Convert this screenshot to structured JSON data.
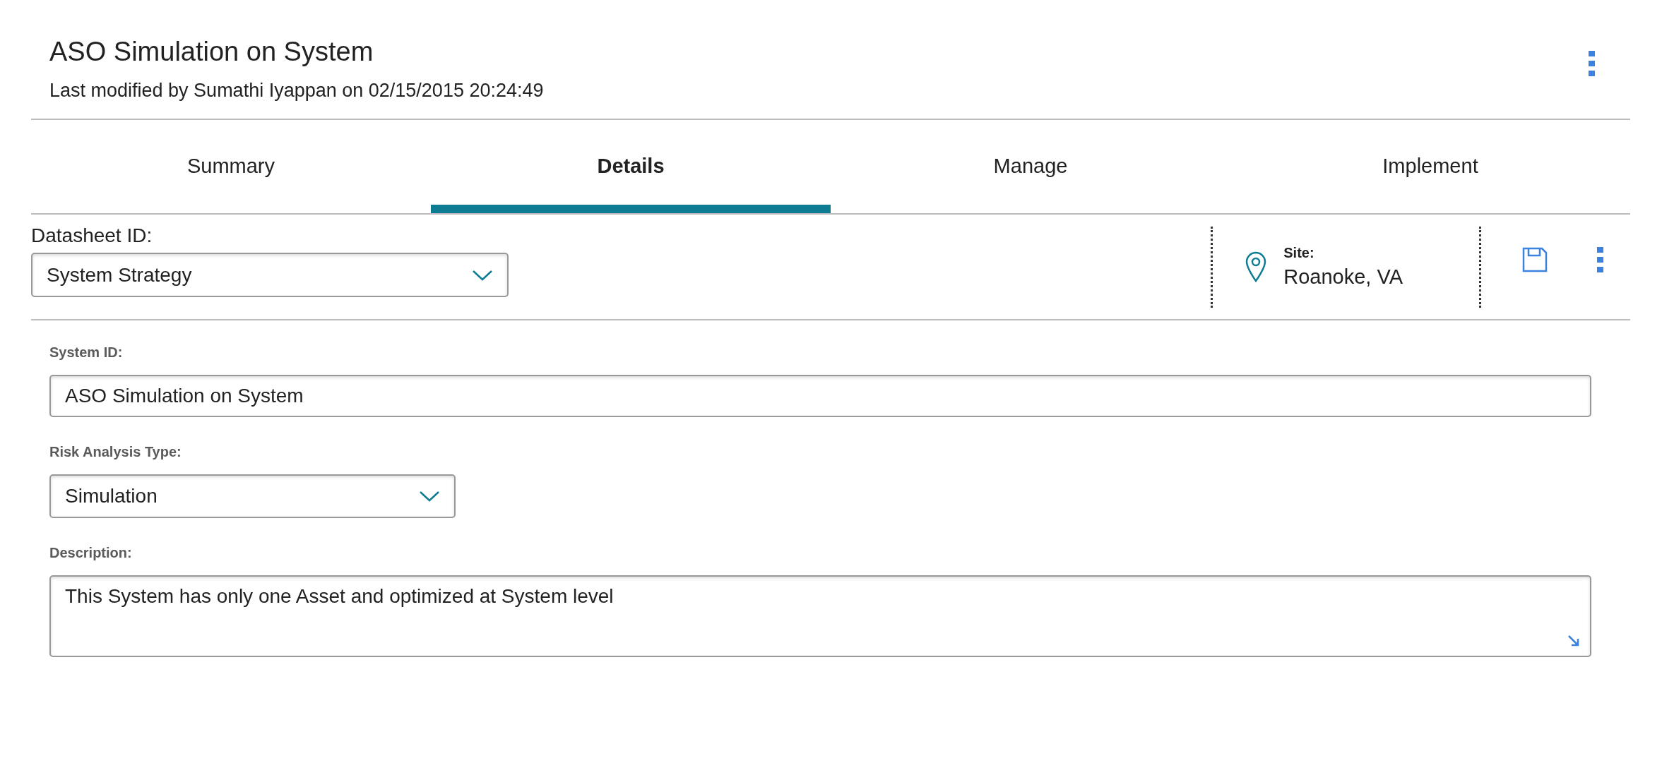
{
  "header": {
    "title": "ASO Simulation on System",
    "subtitle": "Last modified by Sumathi Iyappan on 02/15/2015 20:24:49"
  },
  "tabs": [
    {
      "label": "Summary",
      "selected": false
    },
    {
      "label": "Details",
      "selected": true
    },
    {
      "label": "Manage",
      "selected": false
    },
    {
      "label": "Implement",
      "selected": false
    }
  ],
  "toolbar": {
    "datasheet_label": "Datasheet ID:",
    "datasheet_value": "System Strategy",
    "site_label": "Site:",
    "site_value": "Roanoke, VA"
  },
  "fields": [
    {
      "kind": "text",
      "label": "System ID:",
      "value": "ASO Simulation on System"
    },
    {
      "kind": "dropdown",
      "label": "Risk Analysis Type:",
      "value": "Simulation"
    },
    {
      "kind": "textarea",
      "label": "Description:",
      "value": "This System has only one Asset and optimized at System level"
    }
  ]
}
